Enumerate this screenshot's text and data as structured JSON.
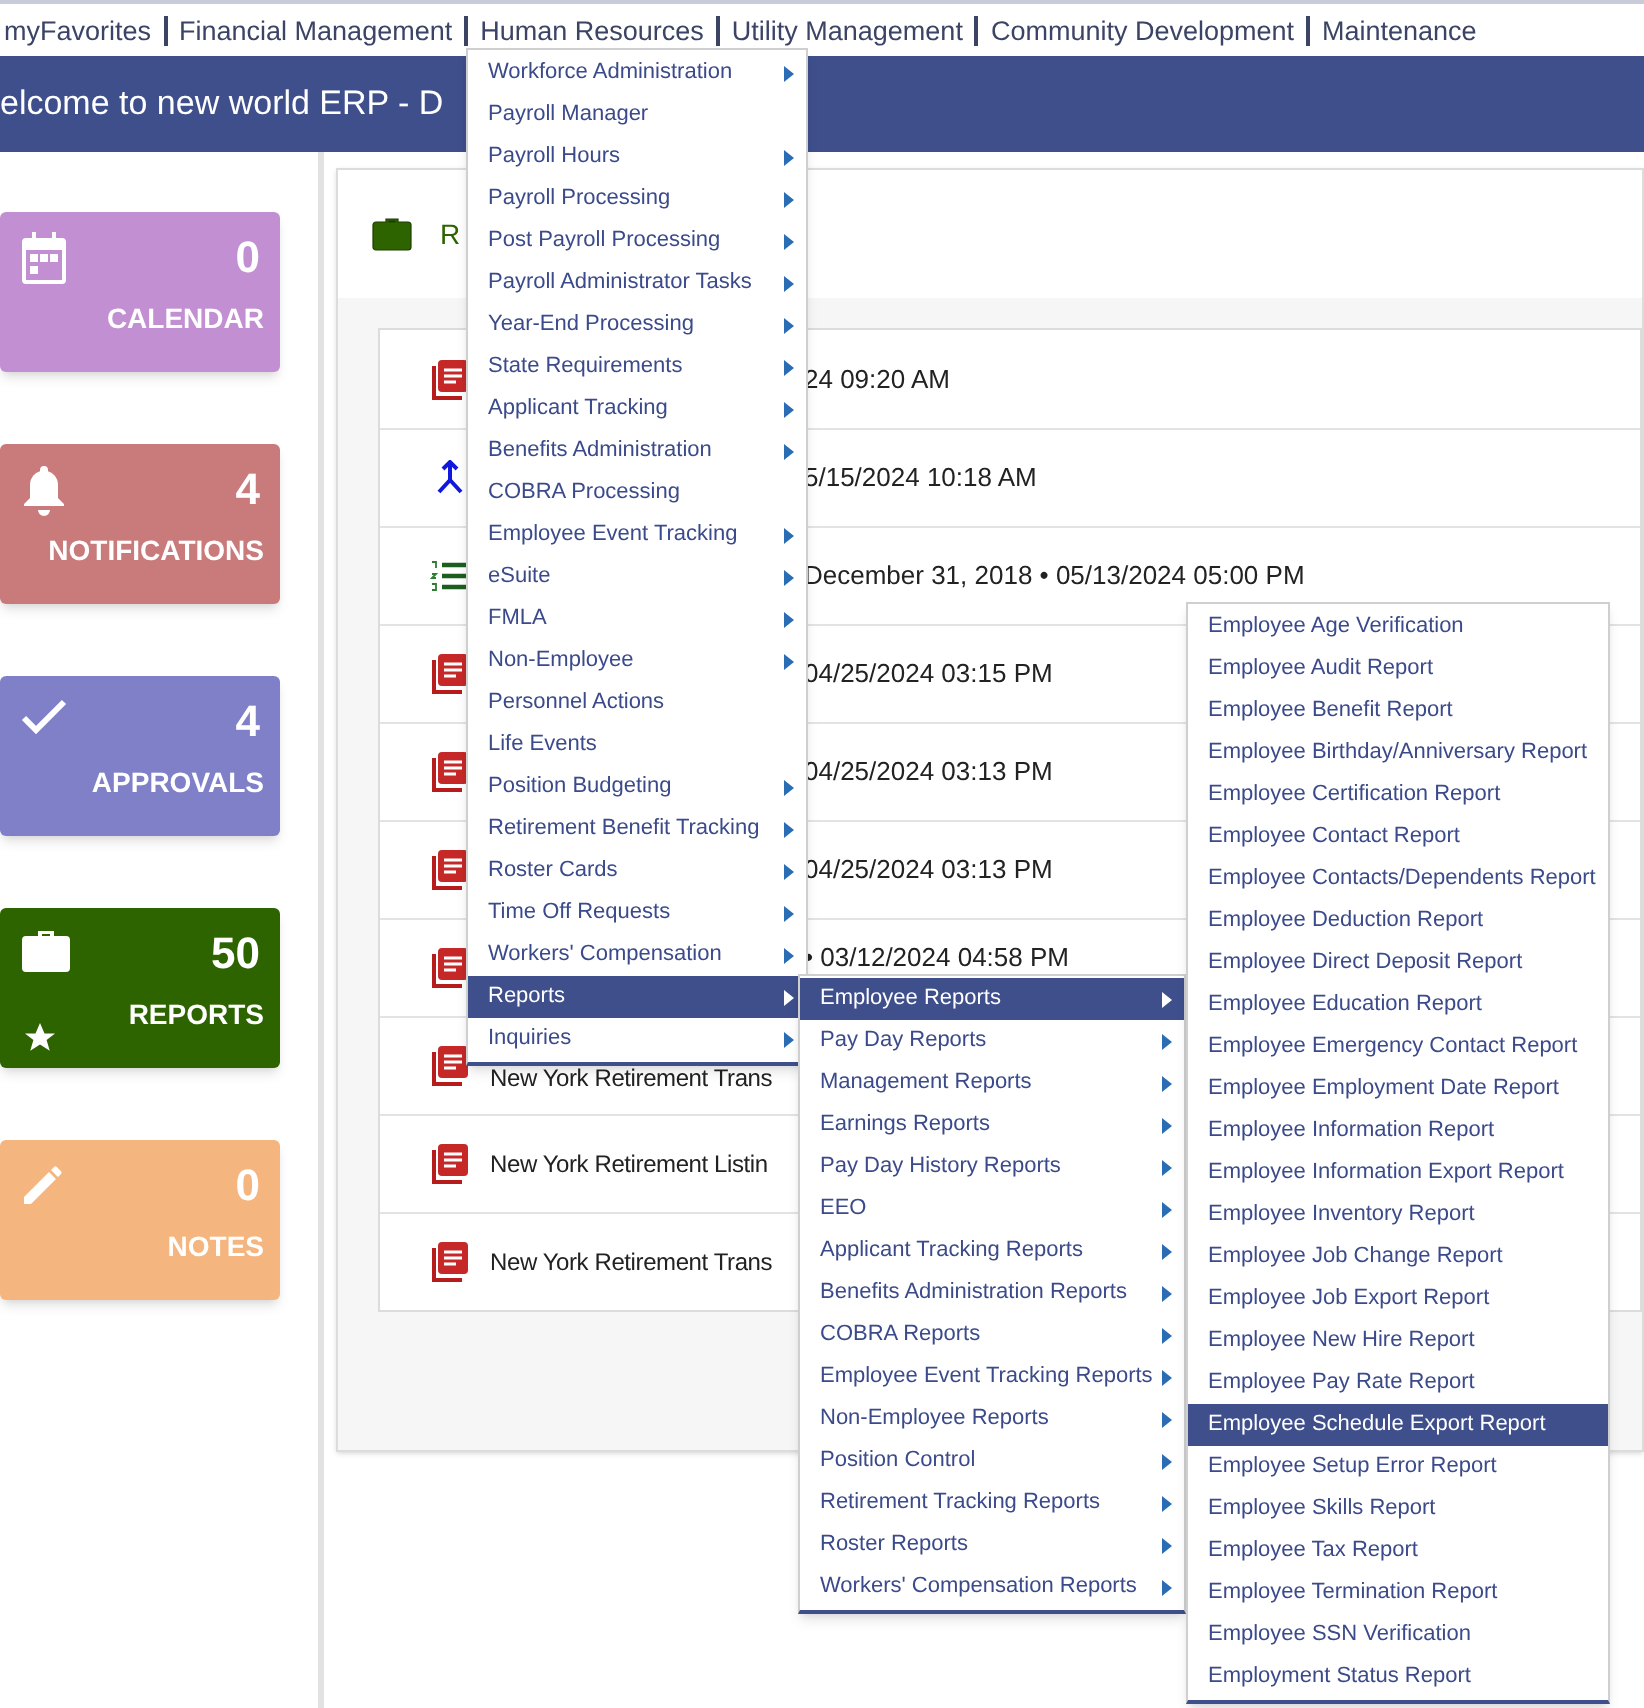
{
  "nav": {
    "items": [
      {
        "label": "myFavorites"
      },
      {
        "label": "Financial Management"
      },
      {
        "label": "Human Resources"
      },
      {
        "label": "Utility Management"
      },
      {
        "label": "Community Development"
      },
      {
        "label": "Maintenance"
      }
    ]
  },
  "header": {
    "title": "elcome to new world ERP - D"
  },
  "tiles": [
    {
      "kind": "calendar",
      "count": "0",
      "label": "CALENDAR",
      "color": "#c38fd3",
      "starred": false
    },
    {
      "kind": "notifications",
      "count": "4",
      "label": "NOTIFICATIONS",
      "color": "#c97b7b",
      "starred": false
    },
    {
      "kind": "approvals",
      "count": "4",
      "label": "APPROVALS",
      "color": "#8080c8",
      "starred": false
    },
    {
      "kind": "reports",
      "count": "50",
      "label": "REPORTS",
      "color": "#2e6400",
      "starred": true
    },
    {
      "kind": "notes",
      "count": "0",
      "label": "NOTES",
      "color": "#f5b57f",
      "starred": false
    }
  ],
  "panel": {
    "title": "R",
    "rows": [
      {
        "kind": "pdf",
        "text": "24 09:20 AM"
      },
      {
        "kind": "merge",
        "text": "5/15/2024 10:18 AM"
      },
      {
        "kind": "list",
        "text": "December 31, 2018 • 05/13/2024 05:00 PM"
      },
      {
        "kind": "pdf",
        "text": "04/25/2024 03:15 PM"
      },
      {
        "kind": "pdf",
        "text": "04/25/2024 03:13 PM"
      },
      {
        "kind": "pdf",
        "text": "04/25/2024 03:13 PM"
      },
      {
        "kind": "pdf",
        "text": "• 03/12/2024 04:58 PM"
      },
      {
        "kind": "pdf",
        "text": "New York Retirement Trans"
      },
      {
        "kind": "pdf",
        "text": "New York Retirement Listin"
      },
      {
        "kind": "pdf",
        "text": "New York Retirement Trans"
      }
    ]
  },
  "menus": [
    {
      "items": [
        {
          "label": "Workforce Administration",
          "has_submenu": true,
          "selected": false
        },
        {
          "label": "Payroll Manager",
          "has_submenu": false,
          "selected": false
        },
        {
          "label": "Payroll Hours",
          "has_submenu": true,
          "selected": false
        },
        {
          "label": "Payroll Processing",
          "has_submenu": true,
          "selected": false
        },
        {
          "label": "Post Payroll Processing",
          "has_submenu": true,
          "selected": false
        },
        {
          "label": "Payroll Administrator Tasks",
          "has_submenu": true,
          "selected": false
        },
        {
          "label": "Year-End Processing",
          "has_submenu": true,
          "selected": false
        },
        {
          "label": "State Requirements",
          "has_submenu": true,
          "selected": false
        },
        {
          "label": "Applicant Tracking",
          "has_submenu": true,
          "selected": false
        },
        {
          "label": "Benefits Administration",
          "has_submenu": true,
          "selected": false
        },
        {
          "label": "COBRA Processing",
          "has_submenu": false,
          "selected": false
        },
        {
          "label": "Employee Event Tracking",
          "has_submenu": true,
          "selected": false
        },
        {
          "label": "eSuite",
          "has_submenu": true,
          "selected": false
        },
        {
          "label": "FMLA",
          "has_submenu": true,
          "selected": false
        },
        {
          "label": "Non-Employee",
          "has_submenu": true,
          "selected": false
        },
        {
          "label": "Personnel Actions",
          "has_submenu": false,
          "selected": false
        },
        {
          "label": "Life Events",
          "has_submenu": false,
          "selected": false
        },
        {
          "label": "Position Budgeting",
          "has_submenu": true,
          "selected": false
        },
        {
          "label": "Retirement Benefit Tracking",
          "has_submenu": true,
          "selected": false
        },
        {
          "label": "Roster Cards",
          "has_submenu": true,
          "selected": false
        },
        {
          "label": "Time Off Requests",
          "has_submenu": true,
          "selected": false
        },
        {
          "label": "Workers' Compensation",
          "has_submenu": true,
          "selected": false
        },
        {
          "label": "Reports",
          "has_submenu": true,
          "selected": true
        },
        {
          "label": "Inquiries",
          "has_submenu": true,
          "selected": false
        }
      ]
    },
    {
      "items": [
        {
          "label": "Employee Reports",
          "has_submenu": true,
          "selected": true
        },
        {
          "label": "Pay Day Reports",
          "has_submenu": true,
          "selected": false
        },
        {
          "label": "Management Reports",
          "has_submenu": true,
          "selected": false
        },
        {
          "label": "Earnings Reports",
          "has_submenu": true,
          "selected": false
        },
        {
          "label": "Pay Day History Reports",
          "has_submenu": true,
          "selected": false
        },
        {
          "label": "EEO",
          "has_submenu": true,
          "selected": false
        },
        {
          "label": "Applicant Tracking Reports",
          "has_submenu": true,
          "selected": false
        },
        {
          "label": "Benefits Administration Reports",
          "has_submenu": true,
          "selected": false
        },
        {
          "label": "COBRA Reports",
          "has_submenu": true,
          "selected": false
        },
        {
          "label": "Employee Event Tracking Reports",
          "has_submenu": true,
          "selected": false
        },
        {
          "label": "Non-Employee Reports",
          "has_submenu": true,
          "selected": false
        },
        {
          "label": "Position Control",
          "has_submenu": true,
          "selected": false
        },
        {
          "label": "Retirement Tracking Reports",
          "has_submenu": true,
          "selected": false
        },
        {
          "label": "Roster Reports",
          "has_submenu": true,
          "selected": false
        },
        {
          "label": "Workers' Compensation Reports",
          "has_submenu": true,
          "selected": false
        }
      ]
    },
    {
      "items": [
        {
          "label": "Employee Age Verification",
          "has_submenu": false,
          "selected": false
        },
        {
          "label": "Employee Audit Report",
          "has_submenu": false,
          "selected": false
        },
        {
          "label": "Employee Benefit Report",
          "has_submenu": false,
          "selected": false
        },
        {
          "label": "Employee Birthday/Anniversary Report",
          "has_submenu": false,
          "selected": false
        },
        {
          "label": "Employee Certification Report",
          "has_submenu": false,
          "selected": false
        },
        {
          "label": "Employee Contact Report",
          "has_submenu": false,
          "selected": false
        },
        {
          "label": "Employee Contacts/Dependents Report",
          "has_submenu": false,
          "selected": false
        },
        {
          "label": "Employee Deduction Report",
          "has_submenu": false,
          "selected": false
        },
        {
          "label": "Employee Direct Deposit Report",
          "has_submenu": false,
          "selected": false
        },
        {
          "label": "Employee Education Report",
          "has_submenu": false,
          "selected": false
        },
        {
          "label": "Employee Emergency Contact Report",
          "has_submenu": false,
          "selected": false
        },
        {
          "label": "Employee Employment Date Report",
          "has_submenu": false,
          "selected": false
        },
        {
          "label": "Employee Information Report",
          "has_submenu": false,
          "selected": false
        },
        {
          "label": "Employee Information Export Report",
          "has_submenu": false,
          "selected": false
        },
        {
          "label": "Employee Inventory Report",
          "has_submenu": false,
          "selected": false
        },
        {
          "label": "Employee Job Change Report",
          "has_submenu": false,
          "selected": false
        },
        {
          "label": "Employee Job Export Report",
          "has_submenu": false,
          "selected": false
        },
        {
          "label": "Employee New Hire Report",
          "has_submenu": false,
          "selected": false
        },
        {
          "label": "Employee Pay Rate Report",
          "has_submenu": false,
          "selected": false
        },
        {
          "label": "Employee Schedule Export Report",
          "has_submenu": false,
          "selected": true
        },
        {
          "label": "Employee Setup Error Report",
          "has_submenu": false,
          "selected": false
        },
        {
          "label": "Employee Skills Report",
          "has_submenu": false,
          "selected": false
        },
        {
          "label": "Employee Tax Report",
          "has_submenu": false,
          "selected": false
        },
        {
          "label": "Employee Termination Report",
          "has_submenu": false,
          "selected": false
        },
        {
          "label": "Employee SSN Verification",
          "has_submenu": false,
          "selected": false
        },
        {
          "label": "Employment Status Report",
          "has_submenu": false,
          "selected": false
        }
      ]
    }
  ]
}
